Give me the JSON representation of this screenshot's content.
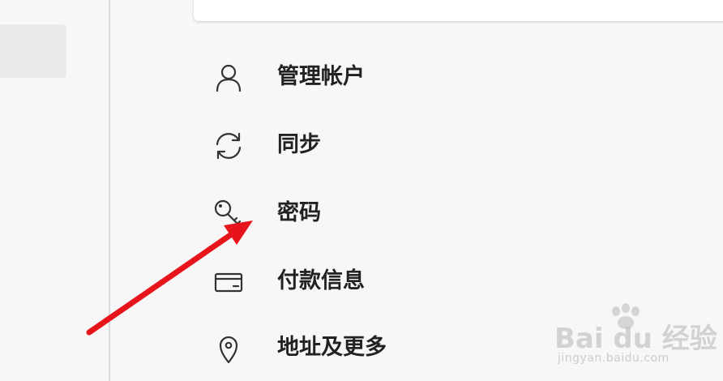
{
  "menu": {
    "items": [
      {
        "label": "管理帐户",
        "icon": "person-icon"
      },
      {
        "label": "同步",
        "icon": "sync-icon"
      },
      {
        "label": "密码",
        "icon": "key-icon"
      },
      {
        "label": "付款信息",
        "icon": "credit-card-icon"
      },
      {
        "label": "地址及更多",
        "icon": "location-pin-icon"
      }
    ]
  },
  "watermark": {
    "logo": "Bai du 经验",
    "url": "jingyan.baidu.com"
  },
  "colors": {
    "arrow": "#e8141b",
    "icon_stroke": "#333333",
    "label": "#222222"
  }
}
